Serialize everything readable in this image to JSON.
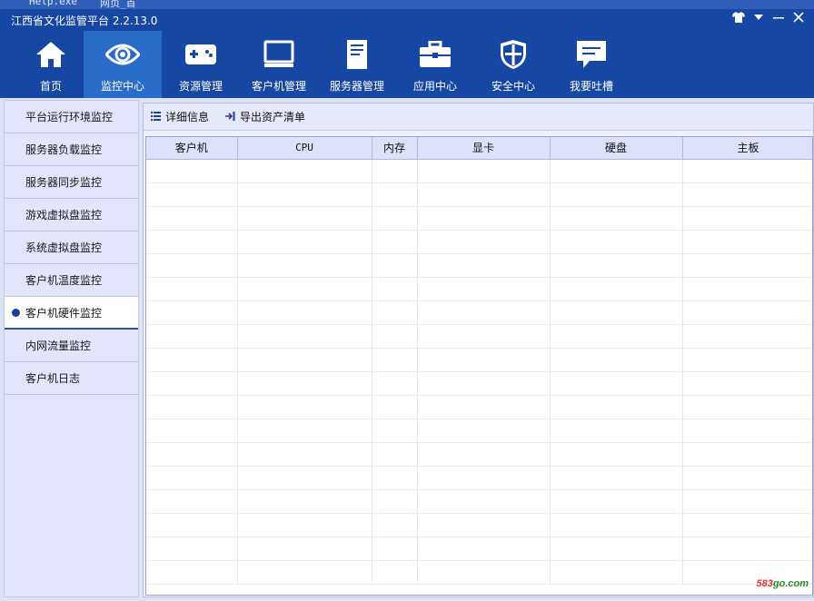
{
  "desktop": {
    "fragment_1": "Help.exe",
    "fragment_2": "网页_首"
  },
  "window": {
    "title": "江西省文化监管平台 2.2.13.0",
    "controls": [
      "shirt-icon",
      "dropdown-icon",
      "minimize-icon",
      "close-icon"
    ]
  },
  "nav": [
    {
      "label": "首页",
      "icon": "home-icon"
    },
    {
      "label": "监控中心",
      "icon": "eye-icon",
      "active": true
    },
    {
      "label": "资源管理",
      "icon": "gamepad-icon"
    },
    {
      "label": "客户机管理",
      "icon": "monitor-icon"
    },
    {
      "label": "服务器管理",
      "icon": "server-icon"
    },
    {
      "label": "应用中心",
      "icon": "toolbox-icon"
    },
    {
      "label": "安全中心",
      "icon": "shield-icon"
    },
    {
      "label": "我要吐槽",
      "icon": "chat-icon"
    }
  ],
  "sidebar": [
    {
      "label": "平台运行环境监控"
    },
    {
      "label": "服务器负载监控"
    },
    {
      "label": "服务器同步监控"
    },
    {
      "label": "游戏虚拟盘监控"
    },
    {
      "label": "系统虚拟盘监控"
    },
    {
      "label": "客户机温度监控"
    },
    {
      "label": "客户机硬件监控",
      "active": true
    },
    {
      "label": "内网流量监控"
    },
    {
      "label": "客户机日志"
    }
  ],
  "toolbar": {
    "details_label": "详细信息",
    "export_label": "导出资产清单"
  },
  "table": {
    "columns": [
      "客户机",
      "CPU",
      "内存",
      "显卡",
      "硬盘",
      "主板"
    ],
    "rows": []
  },
  "watermark": {
    "prefix": "583",
    "suffix": "go.com"
  },
  "colors": {
    "header": "#1647a3",
    "active_tab": "#2a6cc9",
    "panel": "#dde3f7"
  }
}
